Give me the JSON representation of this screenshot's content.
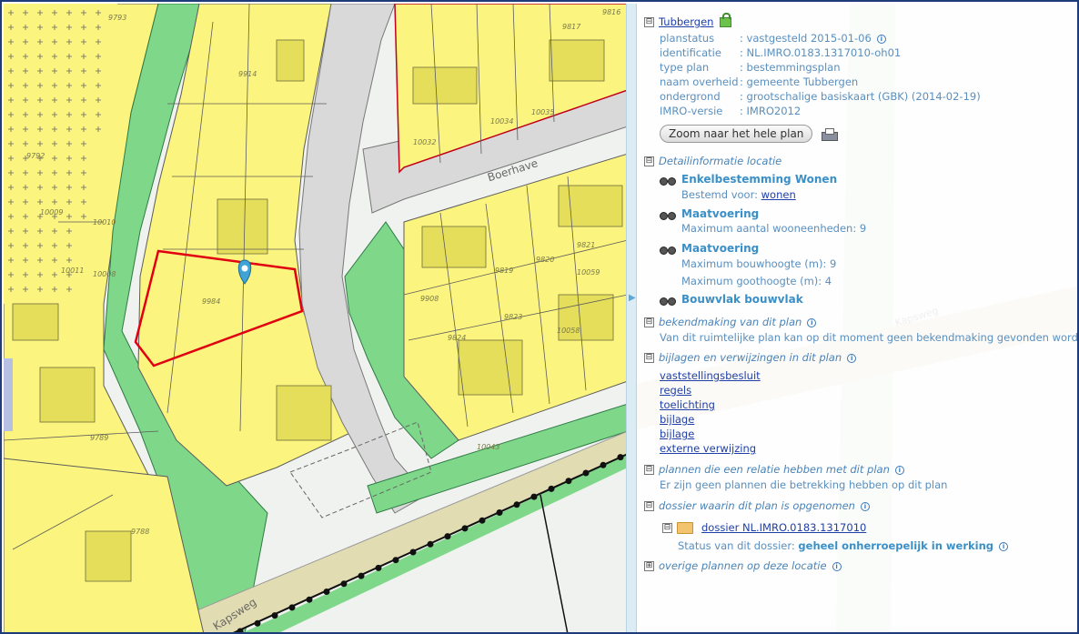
{
  "map": {
    "street_labels": [
      "Boerhave",
      "Kapsweg"
    ],
    "parcel_labels": [
      "9793",
      "9914",
      "9817",
      "9816",
      "10034",
      "10035",
      "10032",
      "9792",
      "10009",
      "10010",
      "10011",
      "10008",
      "9984",
      "9908",
      "9819",
      "9820",
      "9821",
      "10059",
      "9823",
      "10058",
      "9824",
      "10043",
      "9789",
      "9788"
    ],
    "right_label": "Kapsweg"
  },
  "panel": {
    "plan_name": "Tubbergen",
    "fields": [
      {
        "key": "planstatus",
        "value": ": vastgesteld 2015-01-06"
      },
      {
        "key": "identificatie",
        "value": ": NL.IMRO.0183.1317010-oh01"
      },
      {
        "key": "type plan",
        "value": ": bestemmingsplan"
      },
      {
        "key": "naam overheid",
        "value": ": gemeente Tubbergen"
      },
      {
        "key": "ondergrond",
        "value": ": grootschalige basiskaart (GBK) (2014-02-19)"
      },
      {
        "key": "IMRO-versie",
        "value": ": IMRO2012"
      }
    ],
    "zoom_button": "Zoom naar het hele plan",
    "detail_header": "Detailinformatie locatie",
    "detail_items": [
      {
        "title": "Enkelbestemming Wonen",
        "line1_prefix": "Bestemd voor: ",
        "line1_link": "wonen"
      },
      {
        "title": "Maatvoering",
        "line1": "Maximum aantal wooneenheden: 9"
      },
      {
        "title": "Maatvoering",
        "line1": "Maximum bouwhoogte (m): 9",
        "line2": "Maximum goothoogte (m): 4"
      },
      {
        "title": "Bouwvlak bouwvlak"
      }
    ],
    "bekend_header": "bekendmaking van dit plan",
    "bekend_text": "Van dit ruimtelijke plan kan op dit moment geen bekendmaking gevonden worden",
    "bijlagen_header": "bijlagen en verwijzingen in dit plan",
    "bijlagen_links": [
      "vaststellingsbesluit",
      "regels",
      "toelichting",
      "bijlage",
      "bijlage",
      "externe verwijzing"
    ],
    "relatie_header": "plannen die een relatie hebben met dit plan",
    "relatie_text": "Er zijn geen plannen die betrekking hebben op dit plan",
    "dossier_header": "dossier waarin dit plan is opgenomen",
    "dossier_link": "dossier NL.IMRO.0183.1317010",
    "dossier_status_label": "Status van dit dossier: ",
    "dossier_status_value": "geheel onherroepelijk in werking",
    "overige_header": "overige plannen op deze locatie",
    "expand_symbol": "⊟",
    "collapse_symbol": "⊞",
    "info_symbol": "i"
  }
}
